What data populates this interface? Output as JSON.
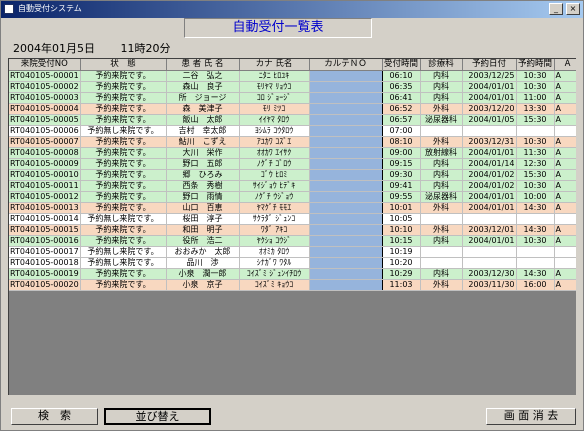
{
  "window": {
    "title": "自動受付システム"
  },
  "header": {
    "caption": "自動受付一覧表",
    "date": "2004年01月5日",
    "time": "11時20分"
  },
  "columns": [
    "来院受付NO",
    "状　態",
    "患 者 氏 名",
    "カナ 氏名",
    "カルテＮＯ",
    "受付時間",
    "診療科",
    "予約日付",
    "予約時間",
    "A"
  ],
  "rows": [
    {
      "no": "RT040105-00001",
      "status": "予約来院です。",
      "name": "二谷　弘之",
      "kana": "ﾆﾀﾆ ﾋﾛﾕｷ",
      "karte": "",
      "time": "06:10",
      "dept": "内科",
      "rdate": "2003/12/25",
      "rtime": "10:30",
      "x": "A",
      "color": "green"
    },
    {
      "no": "RT040105-00002",
      "status": "予約来院です。",
      "name": "森山　良子",
      "kana": "ﾓﾘﾔﾏ ﾘｮｳｺ",
      "karte": "",
      "time": "06:35",
      "dept": "内科",
      "rdate": "2004/01/01",
      "rtime": "10:30",
      "x": "A",
      "color": "green"
    },
    {
      "no": "RT040105-00003",
      "status": "予約来院です。",
      "name": "所　ジョージ",
      "kana": "ｺﾛ ｼﾞｮｰｼﾞ",
      "karte": "",
      "time": "06:41",
      "dept": "内科",
      "rdate": "2004/01/01",
      "rtime": "11:00",
      "x": "A",
      "color": "green"
    },
    {
      "no": "RT040105-00004",
      "status": "予約来院です。",
      "name": "森　美津子",
      "kana": "ﾓﾘ ﾐﾂｺ",
      "karte": "",
      "time": "06:52",
      "dept": "外科",
      "rdate": "2003/12/20",
      "rtime": "13:30",
      "x": "A",
      "color": "orange"
    },
    {
      "no": "RT040105-00005",
      "status": "予約来院です。",
      "name": "飯山　太郎",
      "kana": "ｲｲﾔﾏ ﾀﾛｳ",
      "karte": "",
      "time": "06:57",
      "dept": "泌尿器科",
      "rdate": "2004/01/05",
      "rtime": "15:30",
      "x": "A",
      "color": "green"
    },
    {
      "no": "RT040105-00006",
      "status": "予約無し来院です。",
      "name": "吉村　幸太郎",
      "kana": "ﾖｼﾑﾗ ｺｳﾀﾛｳ",
      "karte": "",
      "time": "07:00",
      "dept": "",
      "rdate": "",
      "rtime": "",
      "x": "",
      "color": "white"
    },
    {
      "no": "RT040105-00007",
      "status": "予約来院です。",
      "name": "鮎川　こずえ",
      "kana": "ｱﾕｶﾜ ｺｽﾞｴ",
      "karte": "",
      "time": "08:10",
      "dept": "外科",
      "rdate": "2003/12/31",
      "rtime": "10:30",
      "x": "A",
      "color": "orange"
    },
    {
      "no": "RT040105-00008",
      "status": "予約来院です。",
      "name": "大川　栄作",
      "kana": "ｵｵｶﾜ ｴｲｻｸ",
      "karte": "",
      "time": "09:00",
      "dept": "放射線科",
      "rdate": "2004/01/01",
      "rtime": "11:30",
      "x": "A",
      "color": "green"
    },
    {
      "no": "RT040105-00009",
      "status": "予約来院です。",
      "name": "野口　五郎",
      "kana": "ﾉｸﾞﾁ ｺﾞﾛｳ",
      "karte": "",
      "time": "09:15",
      "dept": "内科",
      "rdate": "2004/01/14",
      "rtime": "12:30",
      "x": "A",
      "color": "green"
    },
    {
      "no": "RT040105-00010",
      "status": "予約来院です。",
      "name": "郷　ひろみ",
      "kana": "ｺﾞｳ ﾋﾛﾐ",
      "karte": "",
      "time": "09:30",
      "dept": "内科",
      "rdate": "2004/01/02",
      "rtime": "15:30",
      "x": "A",
      "color": "green"
    },
    {
      "no": "RT040105-00011",
      "status": "予約来院です。",
      "name": "西条　秀樹",
      "kana": "ｻｲｼﾞｮｳ ﾋﾃﾞｷ",
      "karte": "",
      "time": "09:41",
      "dept": "内科",
      "rdate": "2004/01/02",
      "rtime": "10:30",
      "x": "A",
      "color": "green"
    },
    {
      "no": "RT040105-00012",
      "status": "予約来院です。",
      "name": "野口　雨情",
      "kana": "ﾉｸﾞﾁ ｳｼﾞｮｳ",
      "karte": "",
      "time": "09:55",
      "dept": "泌尿器科",
      "rdate": "2004/01/01",
      "rtime": "10:00",
      "x": "A",
      "color": "green"
    },
    {
      "no": "RT040105-00013",
      "status": "予約来院です。",
      "name": "山口　百恵",
      "kana": "ﾔﾏｸﾞﾁ ﾓﾓｴ",
      "karte": "",
      "time": "10:01",
      "dept": "外科",
      "rdate": "2004/01/01",
      "rtime": "14:30",
      "x": "A",
      "color": "orange"
    },
    {
      "no": "RT040105-00014",
      "status": "予約無し来院です。",
      "name": "桜田　淳子",
      "kana": "ｻｸﾗﾀﾞ ｼﾞｭﾝｺ",
      "karte": "",
      "time": "10:05",
      "dept": "",
      "rdate": "",
      "rtime": "",
      "x": "",
      "color": "white"
    },
    {
      "no": "RT040105-00015",
      "status": "予約来院です。",
      "name": "和田　明子",
      "kana": "ﾜﾀﾞ ｱｷｺ",
      "karte": "",
      "time": "10:10",
      "dept": "外科",
      "rdate": "2003/12/01",
      "rtime": "14:30",
      "x": "A",
      "color": "orange"
    },
    {
      "no": "RT040105-00016",
      "status": "予約来院です。",
      "name": "役所　浩二",
      "kana": "ﾔｸｼｮ ｺｳｼﾞ",
      "karte": "",
      "time": "10:15",
      "dept": "内科",
      "rdate": "2004/01/01",
      "rtime": "10:30",
      "x": "A",
      "color": "green"
    },
    {
      "no": "RT040105-00017",
      "status": "予約無し来院です。",
      "name": "おおみか　太郎",
      "kana": "ｵｵﾐｶ ﾀﾛｳ",
      "karte": "",
      "time": "10:19",
      "dept": "",
      "rdate": "",
      "rtime": "",
      "x": "",
      "color": "white"
    },
    {
      "no": "RT040105-00018",
      "status": "予約無し来院です。",
      "name": "品川　渉",
      "kana": "ｼﾅｶﾞﾜ ﾜﾀﾙ",
      "karte": "",
      "time": "10:20",
      "dept": "",
      "rdate": "",
      "rtime": "",
      "x": "",
      "color": "white"
    },
    {
      "no": "RT040105-00019",
      "status": "予約来院です。",
      "name": "小泉　潤一郎",
      "kana": "ｺｲｽﾞﾐ ｼﾞｭﾝｲﾁﾛｳ",
      "karte": "",
      "time": "10:29",
      "dept": "内科",
      "rdate": "2003/12/30",
      "rtime": "14:30",
      "x": "A",
      "color": "green"
    },
    {
      "no": "RT040105-00020",
      "status": "予約来院です。",
      "name": "小泉　京子",
      "kana": "ｺｲｽﾞﾐ ｷｮｳｺ",
      "karte": "",
      "time": "11:03",
      "dept": "外科",
      "rdate": "2003/11/30",
      "rtime": "16:00",
      "x": "A",
      "color": "orange"
    }
  ],
  "buttons": {
    "search": "検　索",
    "sort": "並び替え",
    "clear": "画 面 消 去"
  },
  "colors": {
    "reserved": "#ccf0cc",
    "surgery": "#f8d8c0",
    "walk_in": "#ffffff",
    "karte_column": "#96b4dc",
    "caption_text": "#0000cc"
  }
}
